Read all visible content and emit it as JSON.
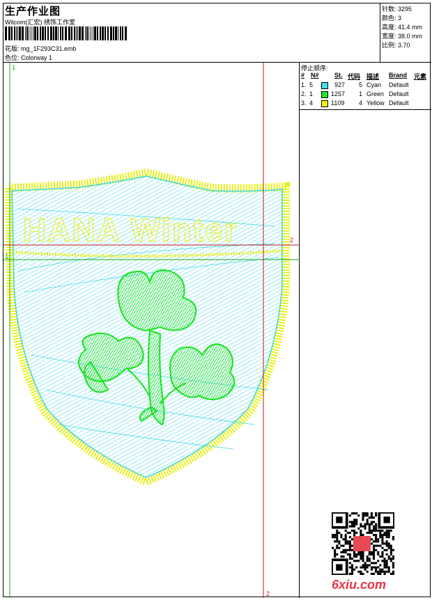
{
  "header": {
    "title": "生产作业图",
    "subtitle": "Wilcom(汇宏) 绣饰工作室",
    "file_line": "花版:  mg_1F293C31.emb",
    "color_line": "色位:  Colorway 1"
  },
  "stats": {
    "stitches": "针数: 3295",
    "colors": "颜色: 3",
    "height": "高度: 41.4 mm",
    "width": "宽度: 38.0 mm",
    "ratio": "比例: 3.70"
  },
  "stop_sequence": {
    "title": "停止顺序:",
    "headers": [
      "#",
      "N#",
      "St.",
      "代码",
      "描述",
      "Brand",
      "元素"
    ],
    "rows": [
      {
        "idx": "1.",
        "n": "5",
        "st": "927",
        "code": "5",
        "desc": "Cyan",
        "brand": "Default",
        "color": "#3fe0ea"
      },
      {
        "idx": "2.",
        "n": "1",
        "st": "1257",
        "code": "1",
        "desc": "Green",
        "brand": "Default",
        "color": "#22e62a"
      },
      {
        "idx": "3.",
        "n": "4",
        "st": "1109",
        "code": "4",
        "desc": "Yellow",
        "brand": "Default",
        "color": "#f2f20f"
      }
    ]
  },
  "design": {
    "text": "HANA Winter",
    "colors": {
      "cyan": "#3fd8e8",
      "green": "#18e41c",
      "yellow": "#e8f01a",
      "guide_red": "#c8141e",
      "guide_green": "#18a818"
    }
  },
  "guides": {
    "v_green_label": "1",
    "h_green_label": "1",
    "v_red_label": "2",
    "h_red_label": "2"
  },
  "watermark": "6xiu.com"
}
